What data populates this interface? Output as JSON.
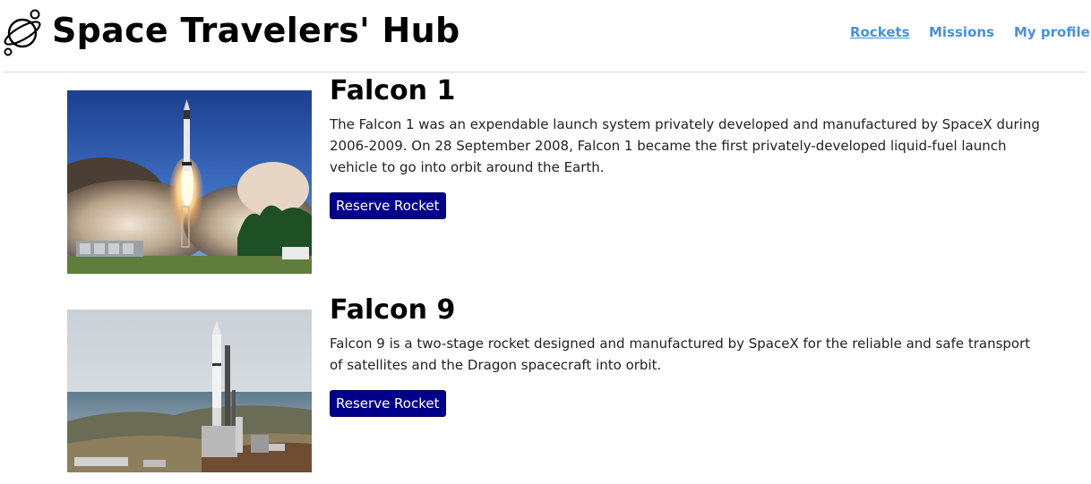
{
  "header": {
    "brand": "Space Travelers' Hub",
    "logo_icon": "planet-icon",
    "nav": [
      {
        "label": "Rockets",
        "active": true
      },
      {
        "label": "Missions",
        "active": false
      },
      {
        "label": "My profile",
        "active": false
      }
    ]
  },
  "colors": {
    "nav_link": "#4a90d9",
    "button_bg": "#00008b",
    "button_text": "#ffffff"
  },
  "rockets": [
    {
      "name": "Falcon 1",
      "description": "The Falcon 1 was an expendable launch system privately developed and manufactured by SpaceX during 2006-2009. On 28 September 2008, Falcon 1 became the first privately-developed liquid-fuel launch vehicle to go into orbit around the Earth.",
      "button_label": "Reserve Rocket"
    },
    {
      "name": "Falcon 9",
      "description": "Falcon 9 is a two-stage rocket designed and manufactured by SpaceX for the reliable and safe transport of satellites and the Dragon spacecraft into orbit.",
      "button_label": "Reserve Rocket"
    }
  ]
}
